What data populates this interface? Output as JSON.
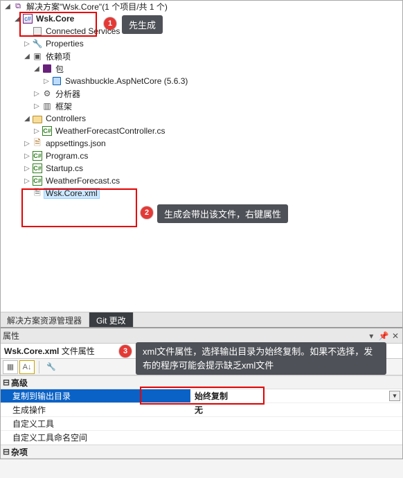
{
  "solutionExplorer": {
    "solutionLine": "解决方案\"Wsk.Core\"(1 个项目/共 1 个)",
    "project": "Wsk.Core",
    "nodes": {
      "connectedServices": "Connected Services",
      "properties": "Properties",
      "dependencies": "依赖项",
      "packages": "包",
      "swashbuckle": "Swashbuckle.AspNetCore (5.6.3)",
      "analyzers": "分析器",
      "frameworks": "框架",
      "controllers": "Controllers",
      "weatherController": "WeatherForecastController.cs",
      "appsettings": "appsettings.json",
      "program": "Program.cs",
      "startup": "Startup.cs",
      "weatherForecast": "WeatherForecast.cs",
      "wskCoreXml": "Wsk.Core.xml"
    },
    "tabs": {
      "solutionExplorer": "解决方案资源管理器",
      "gitChanges": "Git 更改"
    }
  },
  "annotations": {
    "n1": "1",
    "n2": "2",
    "n3": "3",
    "tip1": "先生成",
    "tip2": "生成会带出该文件，右键属性",
    "tip3": "xml文件属性，选择输出目录为始终复制。如果不选择，发布的程序可能会提示缺乏xml文件"
  },
  "propertiesPanel": {
    "title": "属性",
    "subtitle_file": "Wsk.Core.xml",
    "subtitle_kind": "文件属性",
    "categories": {
      "advanced": "高级",
      "misc": "杂项"
    },
    "rows": {
      "copyToOutput_name": "复制到输出目录",
      "copyToOutput_value": "始终复制",
      "buildAction_name": "生成操作",
      "buildAction_value": "无",
      "customTool_name": "自定义工具",
      "customTool_value": "",
      "customToolNs_name": "自定义工具命名空间",
      "customToolNs_value": ""
    }
  },
  "colors": {
    "annotationRed": "#e53935",
    "highlightBorder": "#e40000",
    "selectionBlue": "#0a62c6",
    "tooltipGray": "#4e5157"
  }
}
